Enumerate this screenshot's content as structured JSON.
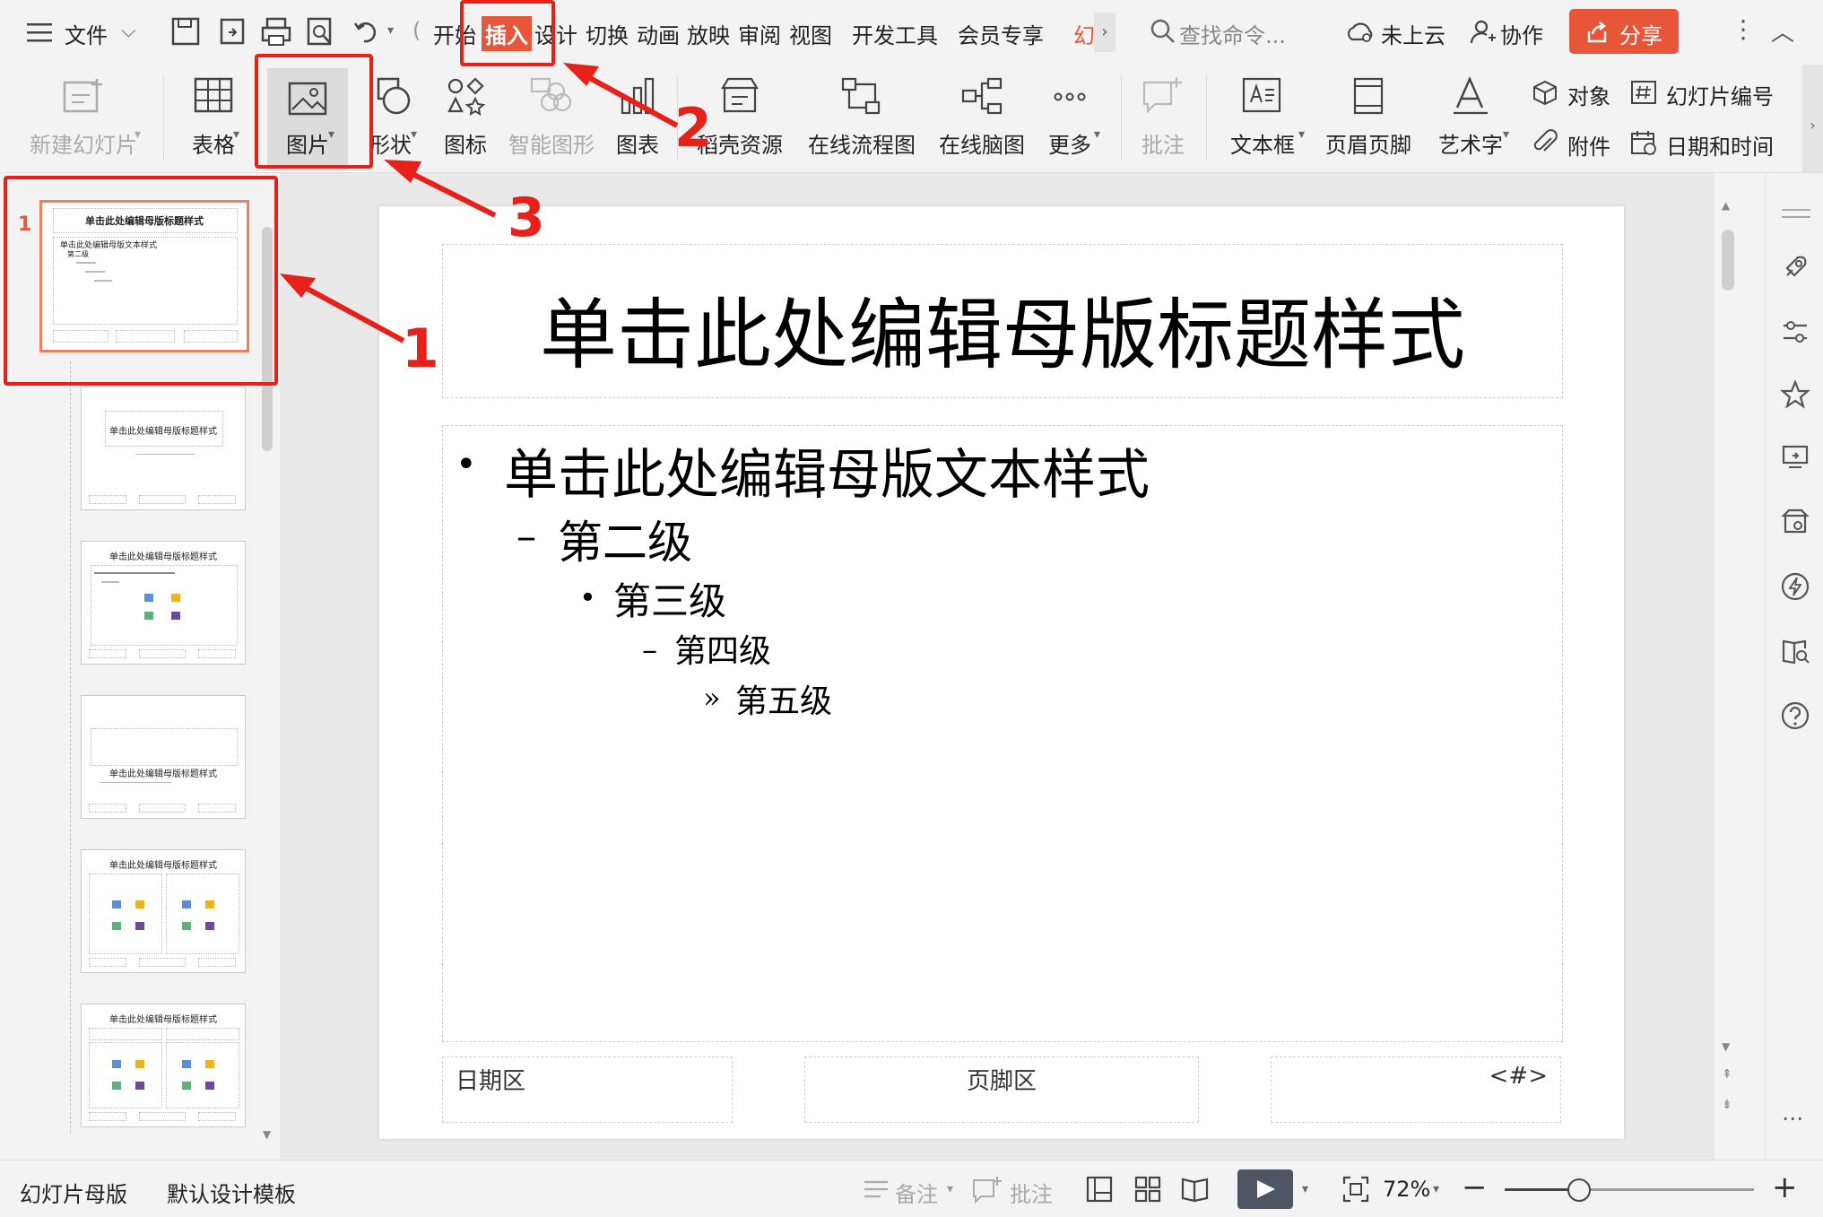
{
  "menubar": {
    "menu_label": "文件",
    "tabs": [
      "开始",
      "插入",
      "设计",
      "切换",
      "动画",
      "放映",
      "审阅",
      "视图",
      "开发工具",
      "会员专享",
      "幻"
    ],
    "search_placeholder": "查找命令...",
    "cloud_label": "未上云",
    "collab_label": "协作",
    "share_label": "分享"
  },
  "ribbon": {
    "new_slide": "新建幻灯片",
    "table": "表格",
    "picture": "图片",
    "shape": "形状",
    "icon": "图标",
    "smart_art": "智能图形",
    "chart": "图表",
    "docer": "稻壳资源",
    "flowchart": "在线流程图",
    "mindmap": "在线脑图",
    "more": "更多",
    "comment": "批注",
    "textbox": "文本框",
    "header_footer": "页眉页脚",
    "wordart": "艺术字",
    "object": "对象",
    "slide_number": "幻灯片编号",
    "attachment": "附件",
    "datetime": "日期和时间"
  },
  "thumbnails": {
    "first_index": "1",
    "master_title": "单击此处编辑母版标题样式",
    "master_body": "单击此处编辑母版文本样式",
    "level2": "第二级",
    "layout_title": "单击此处编辑母版标题样式"
  },
  "slide": {
    "title": "单击此处编辑母版标题样式",
    "levels": [
      "单击此处编辑母版文本样式",
      "第二级",
      "第三级",
      "第四级",
      "第五级"
    ],
    "bullets": [
      "•",
      "–",
      "•",
      "–",
      "»"
    ],
    "date_area": "日期区",
    "footer_area": "页脚区",
    "number_area": "<#>"
  },
  "statusbar": {
    "mode": "幻灯片母版",
    "template": "默认设计模板",
    "notes": "备注",
    "comment": "批注",
    "zoom": "72%",
    "zoom_level": 0.72
  },
  "annotations": [
    "1",
    "2",
    "3"
  ],
  "colors": {
    "accent": "#e8563a",
    "annotation": "#e8201a"
  }
}
